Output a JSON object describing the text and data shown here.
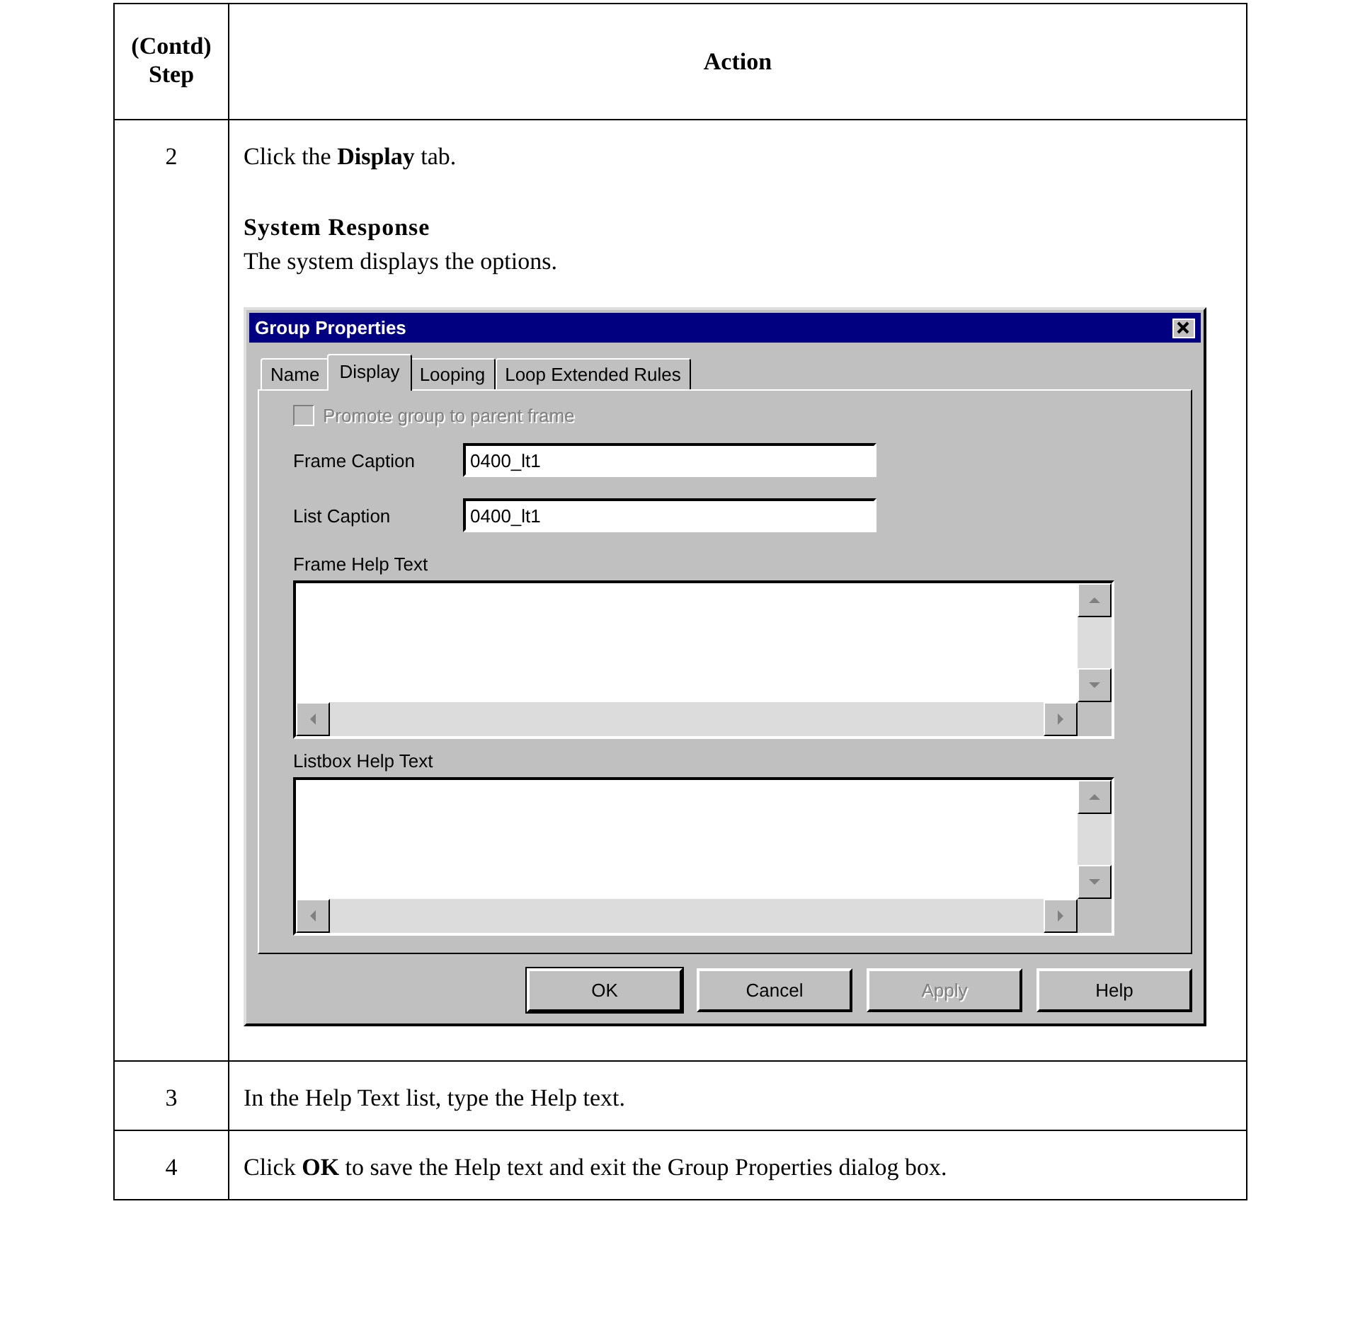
{
  "table": {
    "step_heading": [
      "(Contd)",
      "Step"
    ],
    "action_heading": "Action",
    "rows": [
      {
        "kind": "dialog",
        "step": "2",
        "instruction": "Click the **Display** tab.",
        "response_heading": "System Response",
        "response": "The system displays the options.",
        "dialog": {
          "title": "Group Properties",
          "tabs": [
            {
              "label": "Name",
              "selected": false
            },
            {
              "label": "Display",
              "selected": true
            },
            {
              "label": "Looping",
              "selected": false
            },
            {
              "label": "Loop Extended Rules",
              "selected": false
            }
          ],
          "checkbox": {
            "label": "Promote group to parent frame",
            "checked": false,
            "disabled": true
          },
          "fields": [
            {
              "label": "Frame Caption",
              "value": "0400_lt1"
            },
            {
              "label": "List Caption",
              "value": "0400_lt1"
            }
          ],
          "text_areas": [
            {
              "label": "Frame Help Text"
            },
            {
              "label": "Listbox Help Text"
            }
          ],
          "buttons": [
            {
              "label": "OK",
              "default": true,
              "disabled": false
            },
            {
              "label": "Cancel",
              "default": false,
              "disabled": false
            },
            {
              "label": "Apply",
              "default": false,
              "disabled": true
            },
            {
              "label": "Help",
              "default": false,
              "disabled": false
            }
          ]
        }
      },
      {
        "kind": "text",
        "step": "3",
        "instruction": "In the Help Text list, type the Help text."
      },
      {
        "kind": "text",
        "step": "4",
        "instruction": "Click **OK** to save the Help text and exit the Group Properties dialog box."
      }
    ]
  }
}
